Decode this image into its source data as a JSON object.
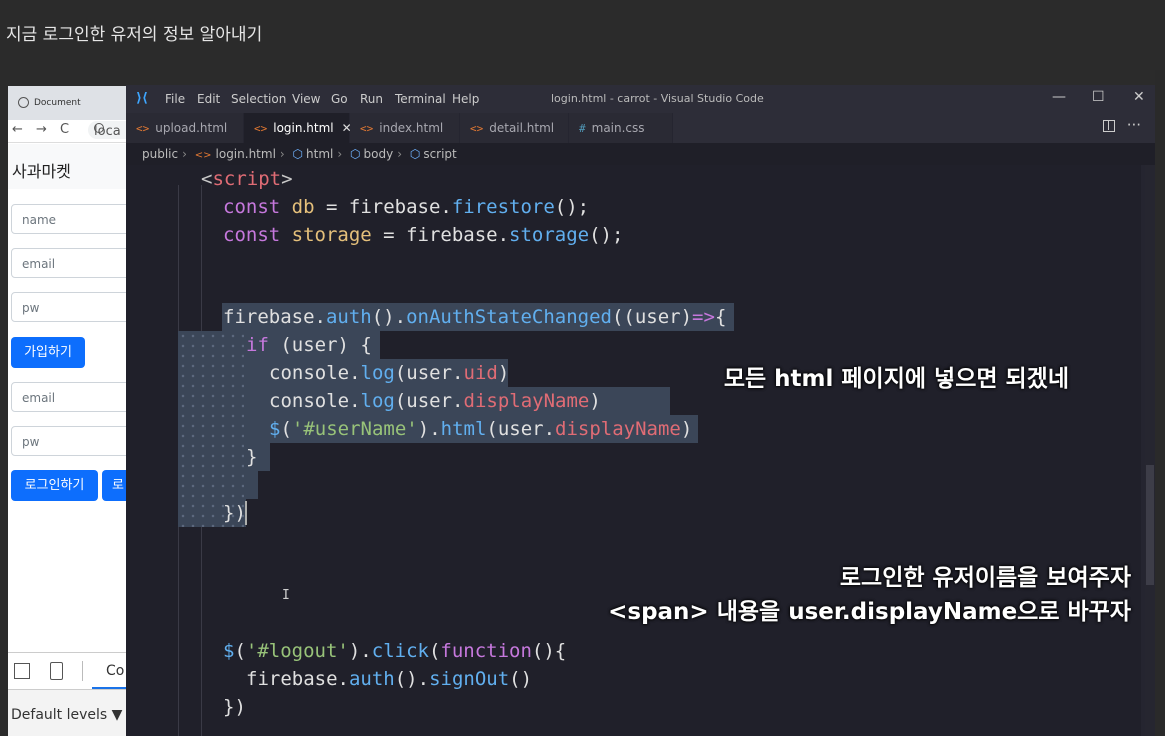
{
  "page_heading": "지금 로그인한 유저의 정보 알아내기",
  "browser": {
    "tab_title": "Document",
    "url": "loca",
    "nav": {
      "back": "←",
      "forward": "→",
      "reload": "C"
    },
    "brand": "사과마켓",
    "signup_form": {
      "name_placeholder": "name",
      "email_placeholder": "email",
      "pw_placeholder": "pw",
      "submit_label": "가입하기"
    },
    "login_form": {
      "email_placeholder": "email",
      "pw_placeholder": "pw",
      "login_label": "로그인하기",
      "logout_label": "로"
    },
    "devtools": {
      "console_tab": "Co",
      "levels_label": "Default levels ▼"
    }
  },
  "vscode": {
    "menu": [
      "File",
      "Edit",
      "Selection",
      "View",
      "Go",
      "Run",
      "Terminal",
      "Help"
    ],
    "window_title": "login.html - carrot - Visual Studio Code",
    "window_controls": {
      "minimize": "—",
      "maximize": "☐",
      "close": "✕"
    },
    "tabs": [
      {
        "label": "upload.html",
        "icon": "<>",
        "active": false
      },
      {
        "label": "login.html",
        "icon": "<>",
        "active": true,
        "close": "✕"
      },
      {
        "label": "index.html",
        "icon": "<>",
        "active": false
      },
      {
        "label": "detail.html",
        "icon": "<>",
        "active": false
      },
      {
        "label": "main.css",
        "icon": "#",
        "active": false
      }
    ],
    "more_actions": "···",
    "breadcrumb": [
      "public",
      "login.html",
      "html",
      "body",
      "script"
    ],
    "code": {
      "l1": {
        "open": "<",
        "tag": "script",
        "close": ">"
      },
      "l2": {
        "kw": "const",
        "name": "db",
        "eq": " = ",
        "obj": "firebase",
        "dot": ".",
        "fn": "firestore",
        "tail": "();"
      },
      "l3": {
        "kw": "const",
        "name": "storage",
        "eq": " = ",
        "obj": "firebase",
        "dot": ".",
        "fn": "storage",
        "tail": "();"
      },
      "l4": {
        "obj": "firebase",
        "dot1": ".",
        "fn1": "auth",
        "p1": "().",
        "fn2": "onAuthStateChanged",
        "p2": "((user)",
        "arrow": "=>",
        "brace": "{"
      },
      "l5": {
        "kw": "if",
        "cond": " (user) {"
      },
      "l6": {
        "obj": "console",
        "dot": ".",
        "fn": "log",
        "open": "(user.",
        "prop": "uid",
        "close": ")"
      },
      "l7": {
        "obj": "console",
        "dot": ".",
        "fn": "log",
        "open": "(user.",
        "prop": "displayName",
        "close": ")"
      },
      "l8": {
        "fn": "$",
        "open": "(",
        "str": "'#userName'",
        "mid": ").",
        "fn2": "html",
        "open2": "(user.",
        "prop": "displayName",
        "close": ")"
      },
      "l9": "}",
      "l10": "})",
      "l11": {
        "fn": "$",
        "open": "(",
        "str": "'#logout'",
        "mid": ").",
        "fn2": "click",
        "open2": "(",
        "kw": "function",
        "tail": "(){"
      },
      "l12": {
        "obj": "firebase",
        "dot": ".",
        "fn": "auth",
        "mid": "().",
        "fn2": "signOut",
        "tail": "()"
      },
      "l13": "})"
    },
    "ibeam": "I"
  },
  "captions": {
    "c1": "모든 html 페이지에 넣으면 되겠네",
    "c2_line1": "로그인한 유저이름을 보여주자",
    "c2_line2": "<span> 내용을 user.displayName으로 바꾸자"
  }
}
